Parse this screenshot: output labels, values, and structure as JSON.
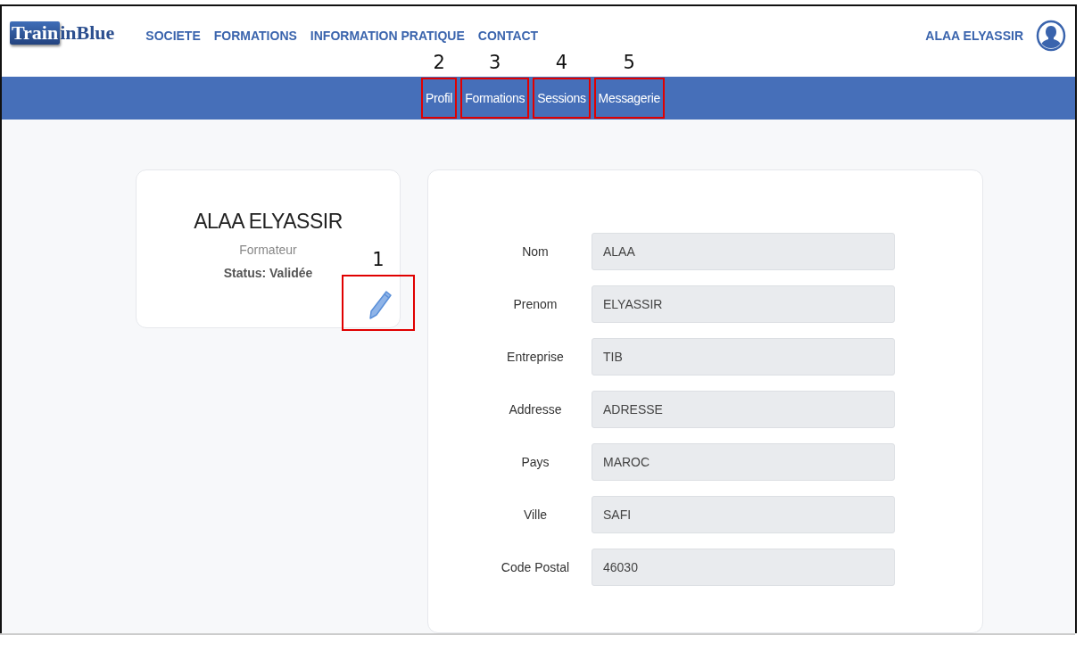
{
  "header": {
    "logo": {
      "boxed": "Train",
      "rest": "inBlue"
    },
    "nav": [
      "SOCIETE",
      "FORMATIONS",
      "INFORMATION PRATIQUE",
      "CONTACT"
    ],
    "user_name": "ALAA ELYASSIR"
  },
  "tabs": [
    {
      "label": "Profil",
      "callout": "2"
    },
    {
      "label": "Formations",
      "callout": "3"
    },
    {
      "label": "Sessions",
      "callout": "4"
    },
    {
      "label": "Messagerie",
      "callout": "5"
    }
  ],
  "profile_card": {
    "name": "ALAA ELYASSIR",
    "role": "Formateur",
    "status": "Status: Validée",
    "edit_callout": "1"
  },
  "form": [
    {
      "label": "Nom",
      "value": "ALAA"
    },
    {
      "label": "Prenom",
      "value": "ELYASSIR"
    },
    {
      "label": "Entreprise",
      "value": "TIB"
    },
    {
      "label": "Addresse",
      "value": "ADRESSE"
    },
    {
      "label": "Pays",
      "value": "MAROC"
    },
    {
      "label": "Ville",
      "value": "SAFI"
    },
    {
      "label": "Code Postal",
      "value": "46030"
    }
  ]
}
